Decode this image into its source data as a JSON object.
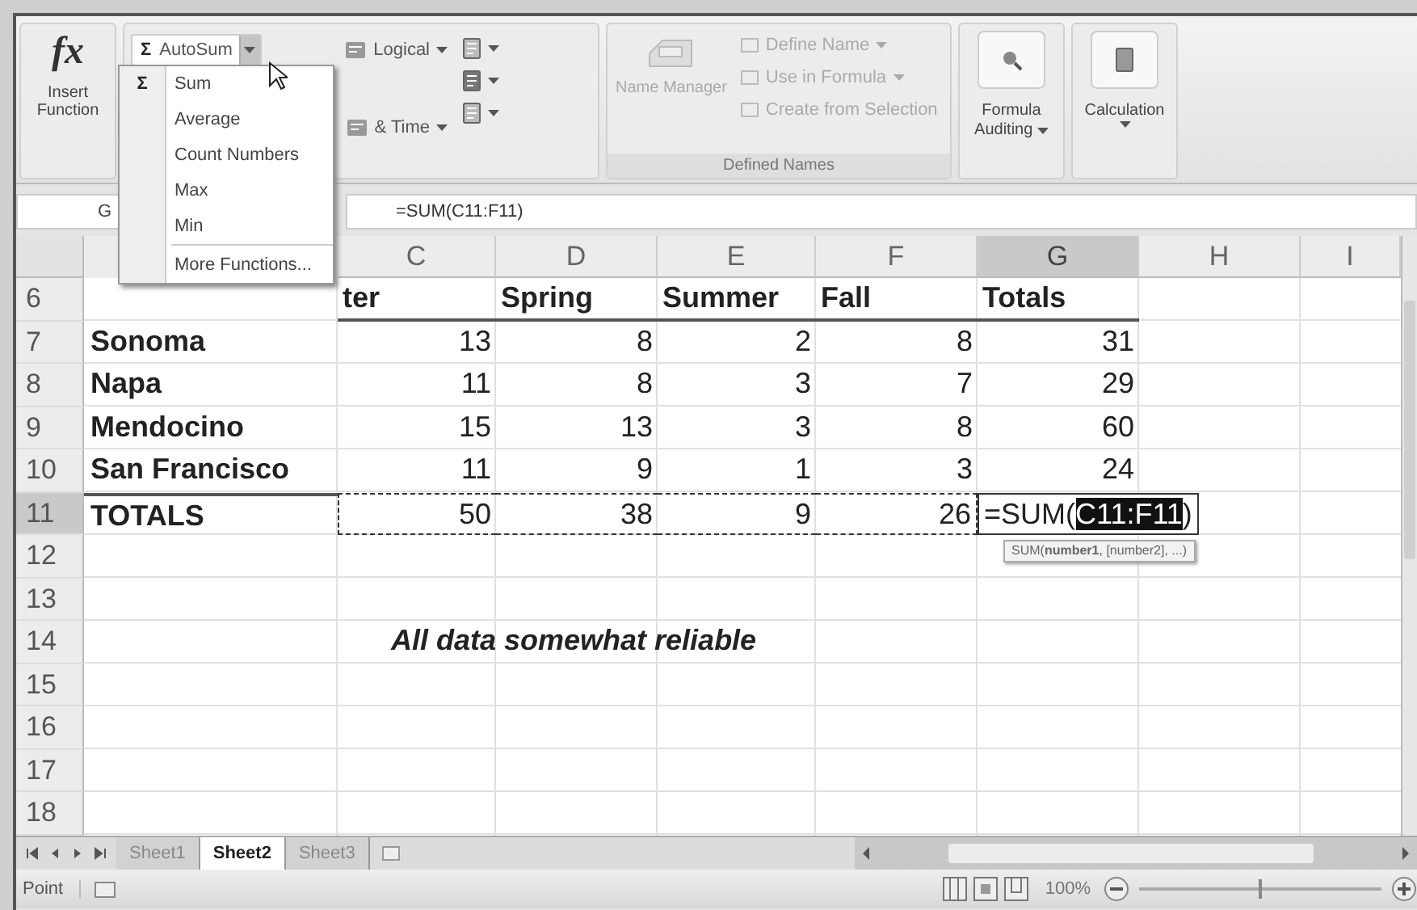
{
  "ribbon": {
    "insert_function": {
      "glyph": "fx",
      "label": "Insert Function"
    },
    "function_library": {
      "autosum": {
        "glyph": "Σ",
        "label": "AutoSum",
        "expanded": true
      },
      "column_2": [
        {
          "label": "Logical",
          "menu": true
        },
        {
          "label": "& Time",
          "menu": true
        }
      ]
    },
    "defined_names": {
      "label": "Defined Names",
      "name_manager": {
        "label": "Name Manager",
        "disabled": true
      },
      "items": [
        {
          "label": "Define Name",
          "menu": true,
          "disabled": true
        },
        {
          "label": "Use in Formula",
          "menu": true,
          "disabled": true
        },
        {
          "label": "Create from Selection",
          "menu": false,
          "disabled": true
        }
      ]
    },
    "formula_auditing": {
      "label": "Formula Auditing",
      "menu": true
    },
    "calculation": {
      "label": "Calculation",
      "menu": true
    }
  },
  "autosum_menu": {
    "items": [
      {
        "glyph": "Σ",
        "label": "Sum",
        "separated": false
      },
      {
        "label": "Average",
        "separated": false
      },
      {
        "label": "Count Numbers",
        "separated": false
      },
      {
        "label": "Max",
        "separated": false
      },
      {
        "label": "Min",
        "separated": false
      },
      {
        "label": "More Functions...",
        "separated": true
      }
    ]
  },
  "formula_bar": {
    "name_box": "G",
    "formula": "=SUM(C11:F11)"
  },
  "sheet": {
    "columns": [
      {
        "selected": false
      },
      {
        "label": "C",
        "selected": false
      },
      {
        "label": "D",
        "selected": false
      },
      {
        "label": "E",
        "selected": false
      },
      {
        "label": "F",
        "selected": false
      },
      {
        "label": "G",
        "selected": true
      },
      {
        "label": "H",
        "selected": false
      },
      {
        "label": "I",
        "selected": false
      }
    ],
    "rows": [
      {
        "number": "6",
        "selected": false,
        "kind": "header",
        "values": [
          "ter",
          "Spring",
          "Summer",
          "Fall",
          "Totals"
        ]
      },
      {
        "number": "7",
        "selected": false,
        "kind": "data",
        "label": "Sonoma",
        "values": [
          "13",
          "8",
          "2",
          "8",
          "31"
        ]
      },
      {
        "number": "8",
        "selected": false,
        "kind": "data",
        "label": "Napa",
        "values": [
          "11",
          "8",
          "3",
          "7",
          "29"
        ]
      },
      {
        "number": "9",
        "selected": false,
        "kind": "data",
        "label": "Mendocino",
        "values": [
          "15",
          "13",
          "3",
          "8",
          "60"
        ]
      },
      {
        "number": "10",
        "selected": false,
        "kind": "data",
        "label": "San Francisco",
        "values": [
          "11",
          "9",
          "1",
          "3",
          "24"
        ]
      },
      {
        "number": "11",
        "selected": true,
        "kind": "total",
        "label": "TOTALS",
        "values": [
          "50",
          "38",
          "9",
          "26"
        ],
        "edit": {
          "prefix": "=SUM(",
          "highlight": "C11:F11",
          "suffix": ")"
        },
        "tooltip": "SUM(**number1**, [number2], ...)"
      },
      {
        "number": "12",
        "selected": false,
        "kind": "empty"
      },
      {
        "number": "13",
        "selected": false,
        "kind": "empty"
      },
      {
        "number": "14",
        "selected": false,
        "kind": "note",
        "note": "All data somewhat reliable"
      },
      {
        "number": "15",
        "selected": false,
        "kind": "empty"
      },
      {
        "number": "16",
        "selected": false,
        "kind": "empty"
      },
      {
        "number": "17",
        "selected": false,
        "kind": "empty"
      },
      {
        "number": "18",
        "selected": false,
        "kind": "empty"
      }
    ]
  },
  "sheet_tabs": [
    {
      "label": "Sheet1",
      "selected": false
    },
    {
      "label": "Sheet2",
      "selected": true
    },
    {
      "label": "Sheet3",
      "selected": false
    }
  ],
  "status_bar": {
    "mode": "Point",
    "zoom": "100%",
    "zoom_slider": {
      "level": 0.5
    }
  }
}
